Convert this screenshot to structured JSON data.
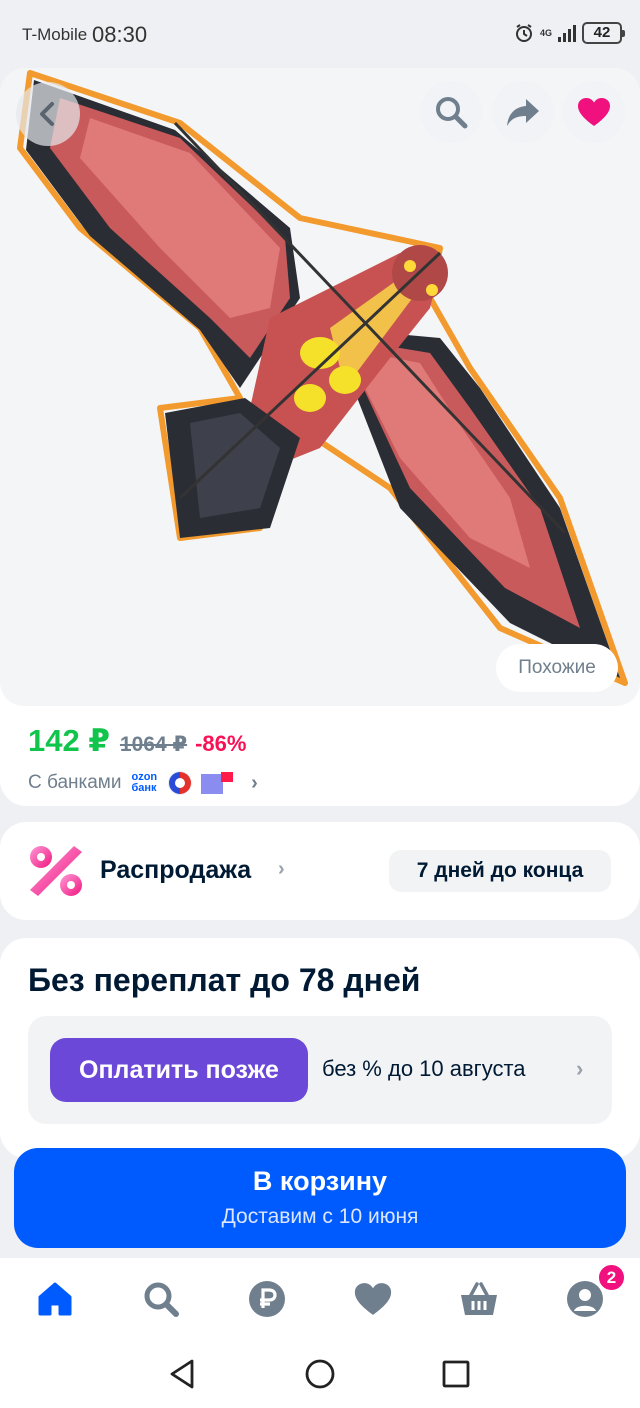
{
  "status_bar": {
    "carrier": "T-Mobile",
    "time": "08:30",
    "network": "4G",
    "battery": "42"
  },
  "product": {
    "image_desc_icon": "eagle-kite-image",
    "similar_label": "Похожие",
    "price": "142 ₽",
    "old_price": "1064 ₽",
    "discount": "-86%",
    "banks_label": "С банками",
    "ozon_bank_line1": "ozon",
    "ozon_bank_line2": "банк"
  },
  "sale": {
    "label": "Распродажа",
    "days_left": "7 дней до конца"
  },
  "installment": {
    "title": "Без переплат до 78 дней",
    "button_label": "Оплатить позже",
    "terms": "без % до 10 августа"
  },
  "cart": {
    "title": "В корзину",
    "subtitle": "Доставим с 10 июня"
  },
  "tab_bar": {
    "items": [
      "home-icon",
      "search-icon",
      "ruble-icon",
      "heart-icon",
      "basket-icon",
      "profile-icon"
    ],
    "profile_badge": "2"
  },
  "colors": {
    "accent": "#005bff",
    "price_green": "#10c44c",
    "discount_red": "#f91155",
    "pay_purple": "#6c48d8",
    "fav_pink": "#f1117e"
  }
}
